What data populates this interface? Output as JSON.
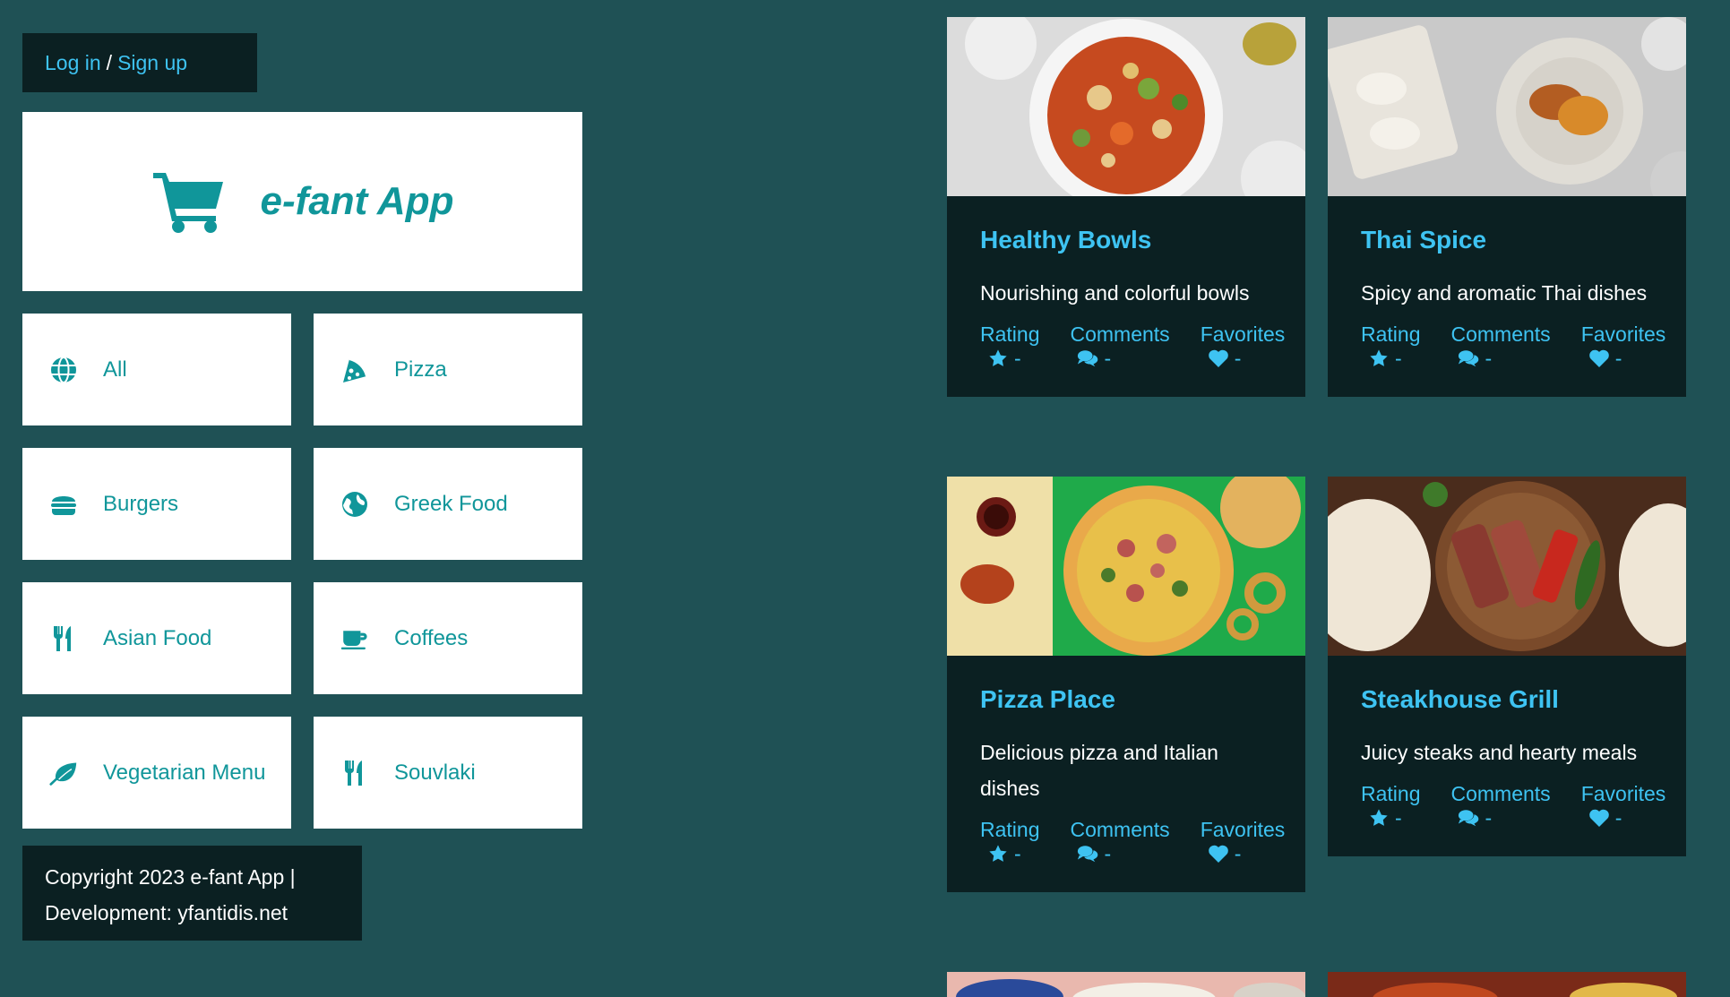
{
  "auth": {
    "login": "Log in",
    "separator": "/",
    "signup": "Sign up"
  },
  "brand": {
    "name": "e-fant App",
    "logo_icon": "shopping-cart-icon"
  },
  "categories": [
    {
      "label": "All",
      "icon": "globe-icon"
    },
    {
      "label": "Pizza",
      "icon": "pizza-slice-icon"
    },
    {
      "label": "Burgers",
      "icon": "burger-icon"
    },
    {
      "label": "Greek Food",
      "icon": "earth-globe-icon"
    },
    {
      "label": "Asian Food",
      "icon": "utensils-icon"
    },
    {
      "label": "Coffees",
      "icon": "coffee-cup-icon"
    },
    {
      "label": "Vegetarian Menu",
      "icon": "leaf-icon"
    },
    {
      "label": "Souvlaki",
      "icon": "utensils-icon"
    }
  ],
  "footer": {
    "line1": "Copyright 2023 e-fant App |",
    "line2": "Development: yfantidis.net"
  },
  "stat_labels": {
    "rating": "Rating",
    "comments": "Comments",
    "favorites": "Favorites"
  },
  "stat_icons": {
    "rating": "star-icon",
    "comments": "comments-icon",
    "favorites": "heart-icon"
  },
  "restaurants": [
    {
      "name": "Healthy Bowls",
      "description": "Nourishing and colorful bowls",
      "rating": "-",
      "comments": "-",
      "favorites": "-"
    },
    {
      "name": "Thai Spice",
      "description": "Spicy and aromatic Thai dishes",
      "rating": "-",
      "comments": "-",
      "favorites": "-"
    },
    {
      "name": "Pizza Place",
      "description": "Delicious pizza and Italian dishes",
      "rating": "-",
      "comments": "-",
      "favorites": "-"
    },
    {
      "name": "Steakhouse Grill",
      "description": "Juicy steaks and hearty meals",
      "rating": "-",
      "comments": "-",
      "favorites": "-"
    }
  ],
  "colors": {
    "background": "#1f5155",
    "panel_dark": "#0b2022",
    "accent": "#3ec3f2",
    "brand_teal": "#10969a"
  }
}
